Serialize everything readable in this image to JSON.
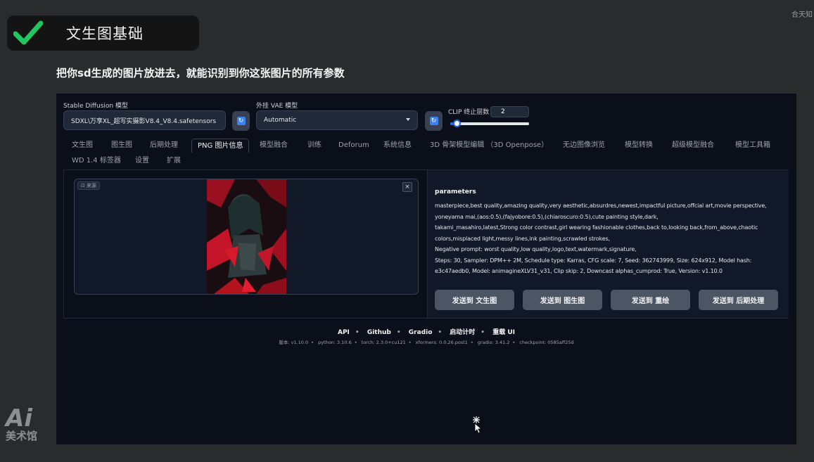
{
  "corner_text": "合天知",
  "lesson": {
    "title": "文生图基础",
    "check_color": "#22c55e"
  },
  "subtitle": "把你sd生成的图片放进去，就能识别到你这张图片的所有参数",
  "controls": {
    "sd_model_label": "Stable Diffusion 模型",
    "sd_model_value": "SDXL\\万享XL_超写实摄影V8.4_V8.4.safetensors",
    "vae_label": "外挂 VAE 模型",
    "vae_value": "Automatic",
    "clip_label": "CLIP 终止层数",
    "clip_value": "2",
    "clip_level": 0.1
  },
  "tabs": [
    "文生图",
    "图生图",
    "后期处理",
    "PNG 图片信息",
    "模型融合",
    "训练",
    "Deforum",
    "系统信息",
    "3D 骨架模型编辑 （3D Openpose）",
    "无边图像浏览",
    "模型转换",
    "超级模型融合",
    "模型工具箱",
    "WD 1.4 标签器",
    "设置",
    "扩展"
  ],
  "active_tab": "PNG 图片信息",
  "image_panel": {
    "source_label": "来源",
    "close": "×"
  },
  "params": {
    "title": "parameters",
    "lines": [
      "masterpiece,best quality,amazing quality,very aesthetic,absurdres,newest,impactful picture,offcial art,movie perspective,",
      "yoneyama mai,(aos:0.5),(fajyobore:0.5),(chiaroscuro:0.5),cute painting style,dark,",
      "takami_masahiro,latest,Strong color contrast,girl wearing fashionable clothes,back to,looking back,from_above,chaotic",
      "colors,misplaced light,messy lines,ink painting,scrawled strokes,",
      "Negative prompt: worst quality,low quality,logo,text,watermark,signature,",
      "Steps: 30, Sampler: DPM++ 2M, Schedule type: Karras, CFG scale: 7, Seed: 362743999, Size: 624x912, Model hash:",
      "e3c47aedb0, Model: animagineXLV31_v31, Clip skip: 2, Downcast alphas_cumprod: True, Version: v1.10.0"
    ]
  },
  "send_buttons": [
    "发送到 文生图",
    "发送到 图生图",
    "发送到 重绘",
    "发送到 后期处理"
  ],
  "footer": {
    "links": [
      "API",
      "Github",
      "Gradio",
      "启动计时",
      "重载 UI"
    ],
    "versions": [
      "版本: v1.10.0",
      "python: 3.10.6",
      "torch: 2.3.0+cu121",
      "xformers: 0.0.26.post1",
      "gradio: 3.41.2",
      "checkpoint: 0585aff25d"
    ]
  },
  "watermark": {
    "big": "Ai",
    "small": "美术馆"
  }
}
